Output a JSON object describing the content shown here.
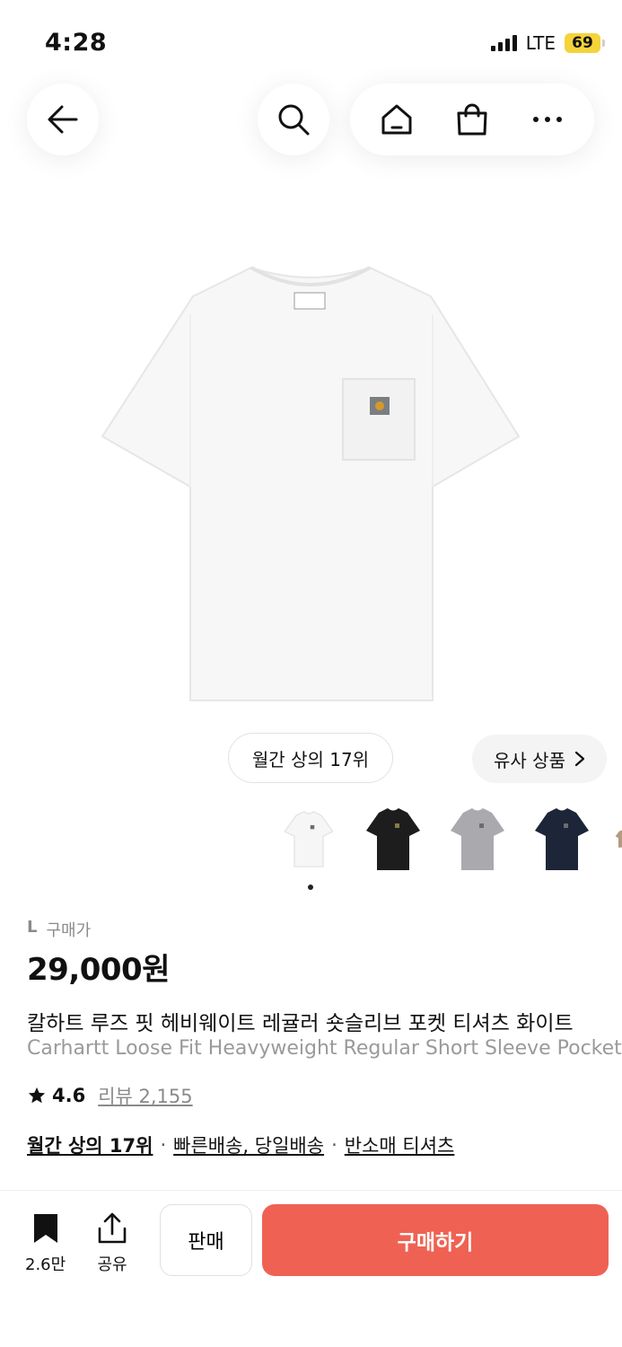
{
  "status_bar": {
    "time": "4:28",
    "network": "LTE",
    "battery": "69"
  },
  "nav": {
    "back_icon": "arrow-left-icon",
    "search_icon": "search-icon",
    "home_icon": "home-icon",
    "cart_icon": "shopping-bag-icon",
    "more_icon": "more-icon"
  },
  "badges": {
    "rank": "월간 상의 17위",
    "similar": "유사 상품"
  },
  "colors": {
    "accent": "#ef6253",
    "swatches": [
      "#f6f6f6",
      "#1d1d1d",
      "#a9a9ae",
      "#1c2638",
      "#b49a7e"
    ]
  },
  "gallery": {
    "current_index": 1
  },
  "product": {
    "size": "L",
    "price_label": "구매가",
    "price": "29,000원",
    "name_ko": "칼하트 루즈 핏 헤비웨이트 레귤러 숏슬리브 포켓 티셔츠 화이트",
    "name_en": "Carhartt Loose Fit Heavyweight Regular Short Sleeve Pocket T-Shirt White",
    "rating": "4.6",
    "review_label": "리뷰 2,155",
    "tags": [
      "월간 상의 17위",
      "빠른배송, 당일배송",
      "반소매 티셔츠"
    ]
  },
  "bottom": {
    "bookmark_count": "2.6만",
    "share_label": "공유",
    "sell_label": "판매",
    "buy_label": "구매하기"
  }
}
